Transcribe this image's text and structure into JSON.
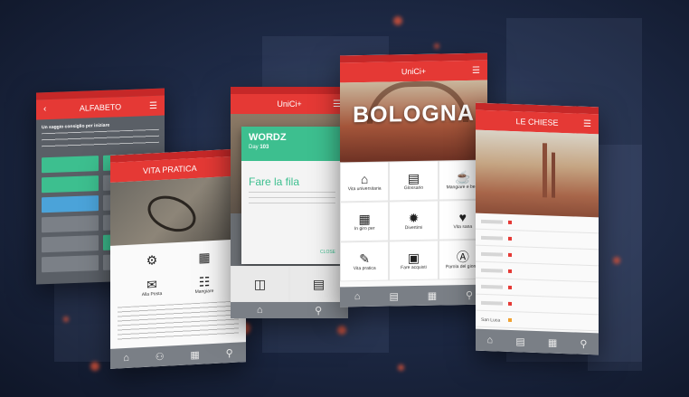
{
  "colors": {
    "accent": "#e53935",
    "accent_dark": "#c62828",
    "teal": "#3dbf8f",
    "blue": "#4ba3d9",
    "bg": "#1e2a46"
  },
  "phone1": {
    "title": "ALFABETO",
    "intro_heading": "Un saggio consiglio per iniziare",
    "intro_text": "",
    "buttons": [
      {
        "label": "",
        "color": "teal"
      },
      {
        "label": "",
        "color": "teal"
      },
      {
        "label": "",
        "color": "teal"
      },
      {
        "label": "",
        "color": "gray"
      },
      {
        "label": "",
        "color": "blue"
      },
      {
        "label": "",
        "color": "gray"
      },
      {
        "label": "",
        "color": "gray"
      },
      {
        "label": "",
        "color": "gray"
      },
      {
        "label": "",
        "color": "gray"
      },
      {
        "label": "",
        "color": "teal"
      },
      {
        "label": "",
        "color": "gray"
      },
      {
        "label": "",
        "color": "gray"
      }
    ]
  },
  "phone2": {
    "title": "VITA PRATICA",
    "tiles": [
      {
        "label": "",
        "icon": "bike-icon"
      },
      {
        "label": "",
        "icon": "atm-icon"
      },
      {
        "label": "Alla Posta",
        "icon": "mail-icon"
      },
      {
        "label": "Mangiare",
        "icon": "menu-icon"
      }
    ],
    "body_text": ""
  },
  "phone3": {
    "title": "UniCi+",
    "card": {
      "brand": "WORDZ",
      "day_label": "Day",
      "day_value": "103",
      "phrase_label": "",
      "phrase": "Fare la fila",
      "meaning": "",
      "close_label": "CLOSE"
    },
    "bottom_tiles": [
      {
        "label": "",
        "icon": "cart-icon"
      },
      {
        "label": "",
        "icon": "book-icon"
      }
    ]
  },
  "phone4": {
    "title": "UniCi+",
    "hero": "BOLOGNA",
    "tiles": [
      {
        "label": "Vita universitaria",
        "icon": "graduation-cap-icon"
      },
      {
        "label": "Glossario",
        "icon": "glossary-icon"
      },
      {
        "label": "Mangiare e bere",
        "icon": "drinks-icon"
      },
      {
        "label": "In giro per",
        "icon": "map-icon"
      },
      {
        "label": "Divertirsi",
        "icon": "party-icon"
      },
      {
        "label": "Vita sana",
        "icon": "health-icon"
      },
      {
        "label": "Vita pratica",
        "icon": "notes-icon"
      },
      {
        "label": "Fare acquisti",
        "icon": "shopping-bag-icon"
      },
      {
        "label": "Parola del giorno",
        "icon": "dictionary-icon"
      }
    ]
  },
  "phone5": {
    "title": "LE CHIESE",
    "rows": [
      "",
      "",
      "",
      "",
      "",
      "",
      "San Luca"
    ]
  }
}
